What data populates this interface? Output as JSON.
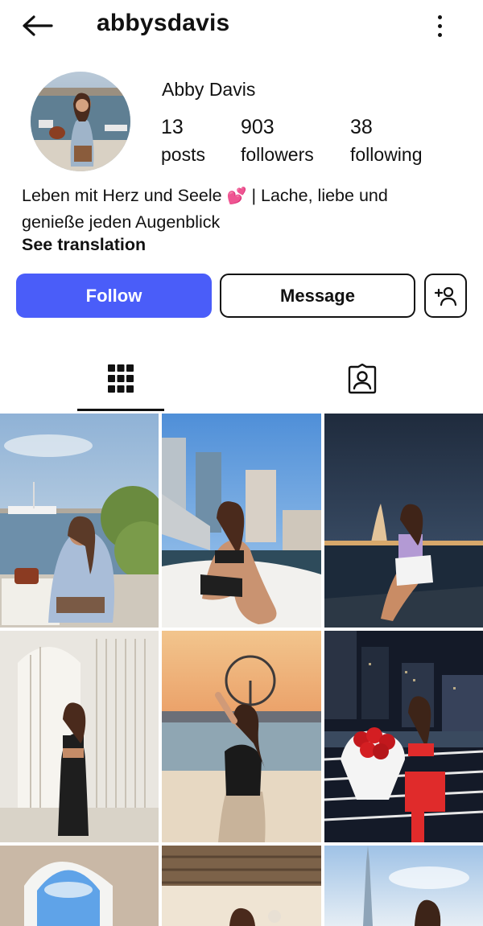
{
  "header": {
    "username": "abbysdavis",
    "back_icon": "arrow-left-icon",
    "more_icon": "more-vertical-icon"
  },
  "profile": {
    "display_name": "Abby Davis",
    "stats": [
      {
        "value": "13",
        "label": "posts"
      },
      {
        "value": "903",
        "label": "followers"
      },
      {
        "value": "38",
        "label": "following"
      }
    ],
    "bio_line1": "Leben mit Herz und Seele",
    "bio_emoji": "💕",
    "bio_line1_end": " | Lache, liebe und",
    "bio_line2": "genieße jeden Augenblick",
    "see_translation": "See translation"
  },
  "actions": {
    "follow_label": "Follow",
    "message_label": "Message",
    "add_user_icon": "add-user-icon"
  },
  "tabs": [
    {
      "name": "grid",
      "icon": "grid-icon",
      "selected": true
    },
    {
      "name": "tagged",
      "icon": "tagged-person-icon",
      "selected": false
    }
  ],
  "colors": {
    "follow_button": "#4a5df9",
    "text": "#111111"
  }
}
